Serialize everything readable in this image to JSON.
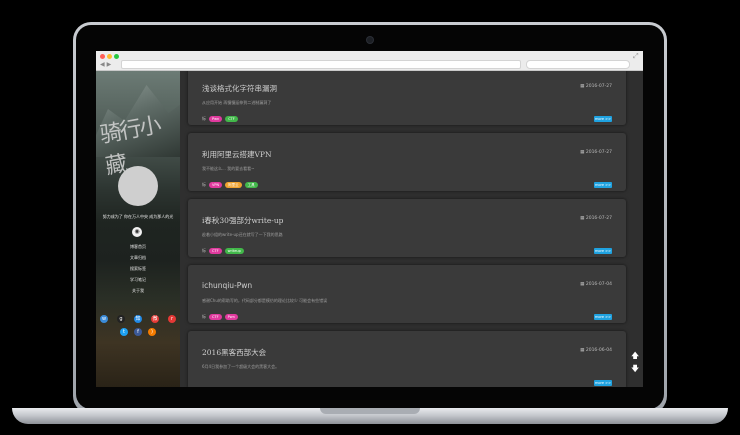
{
  "sidebar": {
    "logo_text": "骑行小藏",
    "motto": "努力成为了 你在万人中央 成为那人的光",
    "menu": [
      "博客首页",
      "文章归档",
      "搜索标签",
      "学习笔记",
      "关于我"
    ],
    "social_icons": [
      "weibo-icon",
      "github-icon",
      "zhihu-icon",
      "weibo2-icon",
      "rss-icon",
      "twitter-icon",
      "facebook-icon",
      "feed-icon"
    ]
  },
  "posts": [
    {
      "title": "浅谈格式化字符串漏洞",
      "date": "2016-07-27",
      "excerpt": "从应用开始 再慢慢延伸到二进制漏洞了",
      "tag_label": "标",
      "tags": [
        {
          "text": "Pwn",
          "color": "#e03a9e"
        },
        {
          "text": "CTF",
          "color": "#42b84a"
        }
      ],
      "more": "more >>"
    },
    {
      "title": "利用阿里云搭建VPN",
      "date": "2016-07-27",
      "excerpt": "我不能这么... 我的要去看看~",
      "tag_label": "标",
      "tags": [
        {
          "text": "VPN",
          "color": "#e03a9e"
        },
        {
          "text": "阿里云",
          "color": "#f0a32f"
        },
        {
          "text": "工具",
          "color": "#42b84a"
        }
      ],
      "more": "more >>"
    },
    {
      "title": "i春秋30强部分write-up",
      "date": "2016-07-27",
      "excerpt": "趁着小组的write-up还在就写了一下我的思路",
      "tag_label": "标",
      "tags": [
        {
          "text": "CTF",
          "color": "#e03a9e"
        },
        {
          "text": "writeup",
          "color": "#42b84a"
        }
      ],
      "more": "more >>"
    },
    {
      "title": "ichunqiu-Pwn",
      "date": "2016-07-04",
      "excerpt": "感谢Chu的帮助写的，代码部分都是模仿的理论比较少 可能会有些错误",
      "tag_label": "标",
      "tags": [
        {
          "text": "CTF",
          "color": "#e03a9e"
        },
        {
          "text": "Pwn",
          "color": "#e03a9e"
        }
      ],
      "more": "more >>"
    },
    {
      "title": "2016黑客西部大会",
      "date": "2016-06-04",
      "excerpt": "6月4日我参加了一个超级大会的黑客大会。",
      "tag_label": "",
      "tags": [],
      "more": "more >>"
    }
  ],
  "colors": {
    "accent": "#1fa2e0"
  }
}
